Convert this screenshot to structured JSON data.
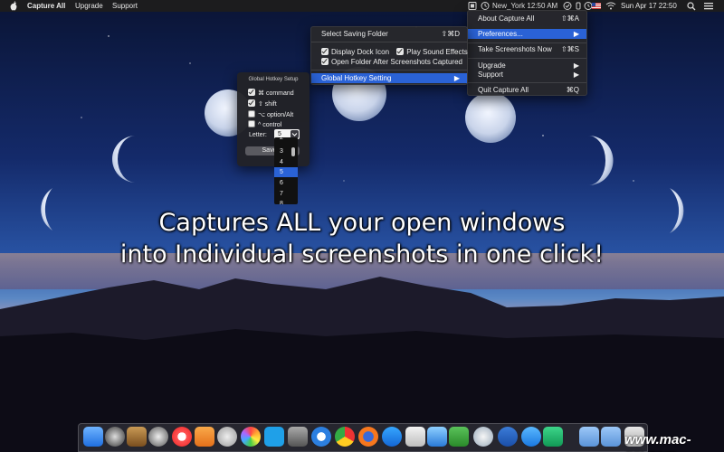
{
  "menubar": {
    "app_name": "Capture All",
    "items": [
      "Upgrade",
      "Support"
    ],
    "clock": "New_York 12:50 AM",
    "date": "Sun Apr 17  22:50"
  },
  "app_menu": {
    "items": [
      {
        "label": "About Capture All",
        "shortcut": "⇧⌘A"
      },
      {
        "label": "Preferences...",
        "shortcut": "▶"
      },
      {
        "label": "Take Screenshots Now",
        "shortcut": "⇧⌘S"
      },
      {
        "label": "Upgrade",
        "shortcut": "▶"
      },
      {
        "label": "Support",
        "shortcut": "▶"
      },
      {
        "label": "Quit Capture All",
        "shortcut": "⌘Q"
      }
    ]
  },
  "prefs_menu": {
    "saving_folder": "Select Saving Folder",
    "saving_shortcut": "⇧⌘D",
    "display_dock_icon": "Display Dock Icon",
    "play_sound": "Play Sound Effects",
    "open_folder": "Open Folder After Screenshots Captured",
    "hotkey_setting": "Global Hotkey Setting",
    "hotkey_arrow": "▶"
  },
  "hotkey_panel": {
    "title": "Global Hotkey Setup",
    "command": "⌘ command",
    "shift": "⇧ shift",
    "option": "⌥ option/Alt",
    "control": "^ control",
    "letter_label": "Letter:",
    "letter_value": "5",
    "save_label": "Save H"
  },
  "letter_options": [
    "2",
    "3",
    "4",
    "5",
    "6",
    "7",
    "8"
  ],
  "caption": {
    "line1": "Captures ALL your open windows",
    "line2": "into Individual screenshots in one click!"
  },
  "watermark": "www.mac-gm.com"
}
